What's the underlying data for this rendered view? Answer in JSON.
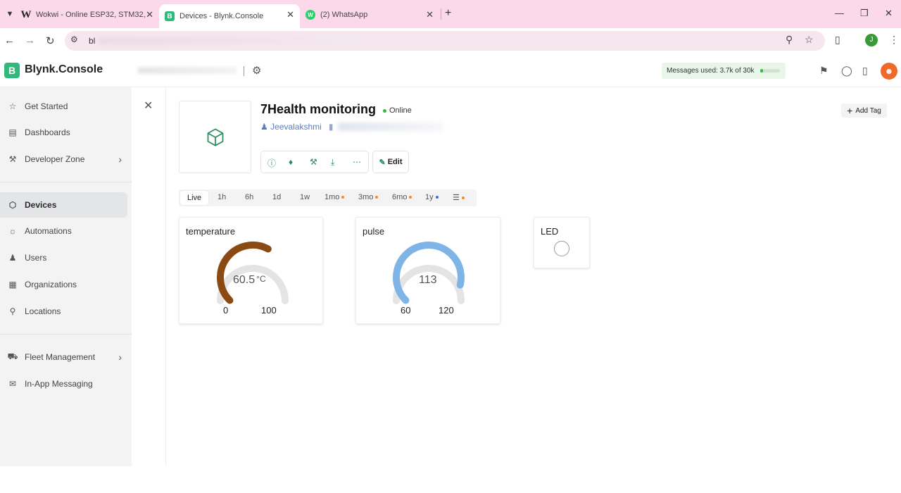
{
  "browser": {
    "tabs": [
      {
        "title": "Wokwi - Online ESP32, STM32,",
        "fav": "W"
      },
      {
        "title": "Devices - Blynk.Console",
        "fav": "B"
      },
      {
        "title": "(2) WhatsApp",
        "fav": "W"
      }
    ],
    "url_fragment": "bl",
    "profile_initial": "J"
  },
  "header": {
    "brand_initial": "B",
    "brand": "Blynk.Console",
    "messages_used": "Messages used: 3.7k of 30k",
    "messages_fraction": 0.123,
    "avatar_icon": "user-icon"
  },
  "sidebar": {
    "items": [
      {
        "label": "Get Started",
        "icon": "star-icon"
      },
      {
        "label": "Dashboards",
        "icon": "bar-chart-icon"
      },
      {
        "label": "Developer Zone",
        "icon": "tools-icon"
      },
      {
        "label": "Devices",
        "icon": "cube-icon",
        "active": true
      },
      {
        "label": "Automations",
        "icon": "automation-icon"
      },
      {
        "label": "Users",
        "icon": "users-icon"
      },
      {
        "label": "Organizations",
        "icon": "building-icon"
      },
      {
        "label": "Locations",
        "icon": "pin-icon"
      },
      {
        "label": "Fleet Management",
        "icon": "truck-icon"
      },
      {
        "label": "In-App Messaging",
        "icon": "message-icon"
      }
    ]
  },
  "device": {
    "name": "7Health monitoring",
    "status": "Online",
    "owner": "Jeevalakshmi",
    "edit_label": "Edit",
    "add_tag_label": "Add Tag"
  },
  "periods": {
    "items": [
      "Live",
      "1h",
      "6h",
      "1d",
      "1w",
      "1mo",
      "3mo",
      "6mo",
      "1y"
    ],
    "dot_colors": {
      "1mo": "#f08a24",
      "3mo": "#f08a24",
      "6mo": "#f08a24",
      "1y": "#2f6fd6",
      "custom": "#f08a24"
    }
  },
  "widgets": {
    "temperature": {
      "title": "temperature",
      "value": "60.5",
      "unit": "°C",
      "min": "0",
      "max": "100",
      "color": "#8a4a12"
    },
    "pulse": {
      "title": "pulse",
      "value": "113",
      "min": "60",
      "max": "120",
      "color": "#7fb4e6"
    },
    "led": {
      "title": "LED"
    }
  }
}
